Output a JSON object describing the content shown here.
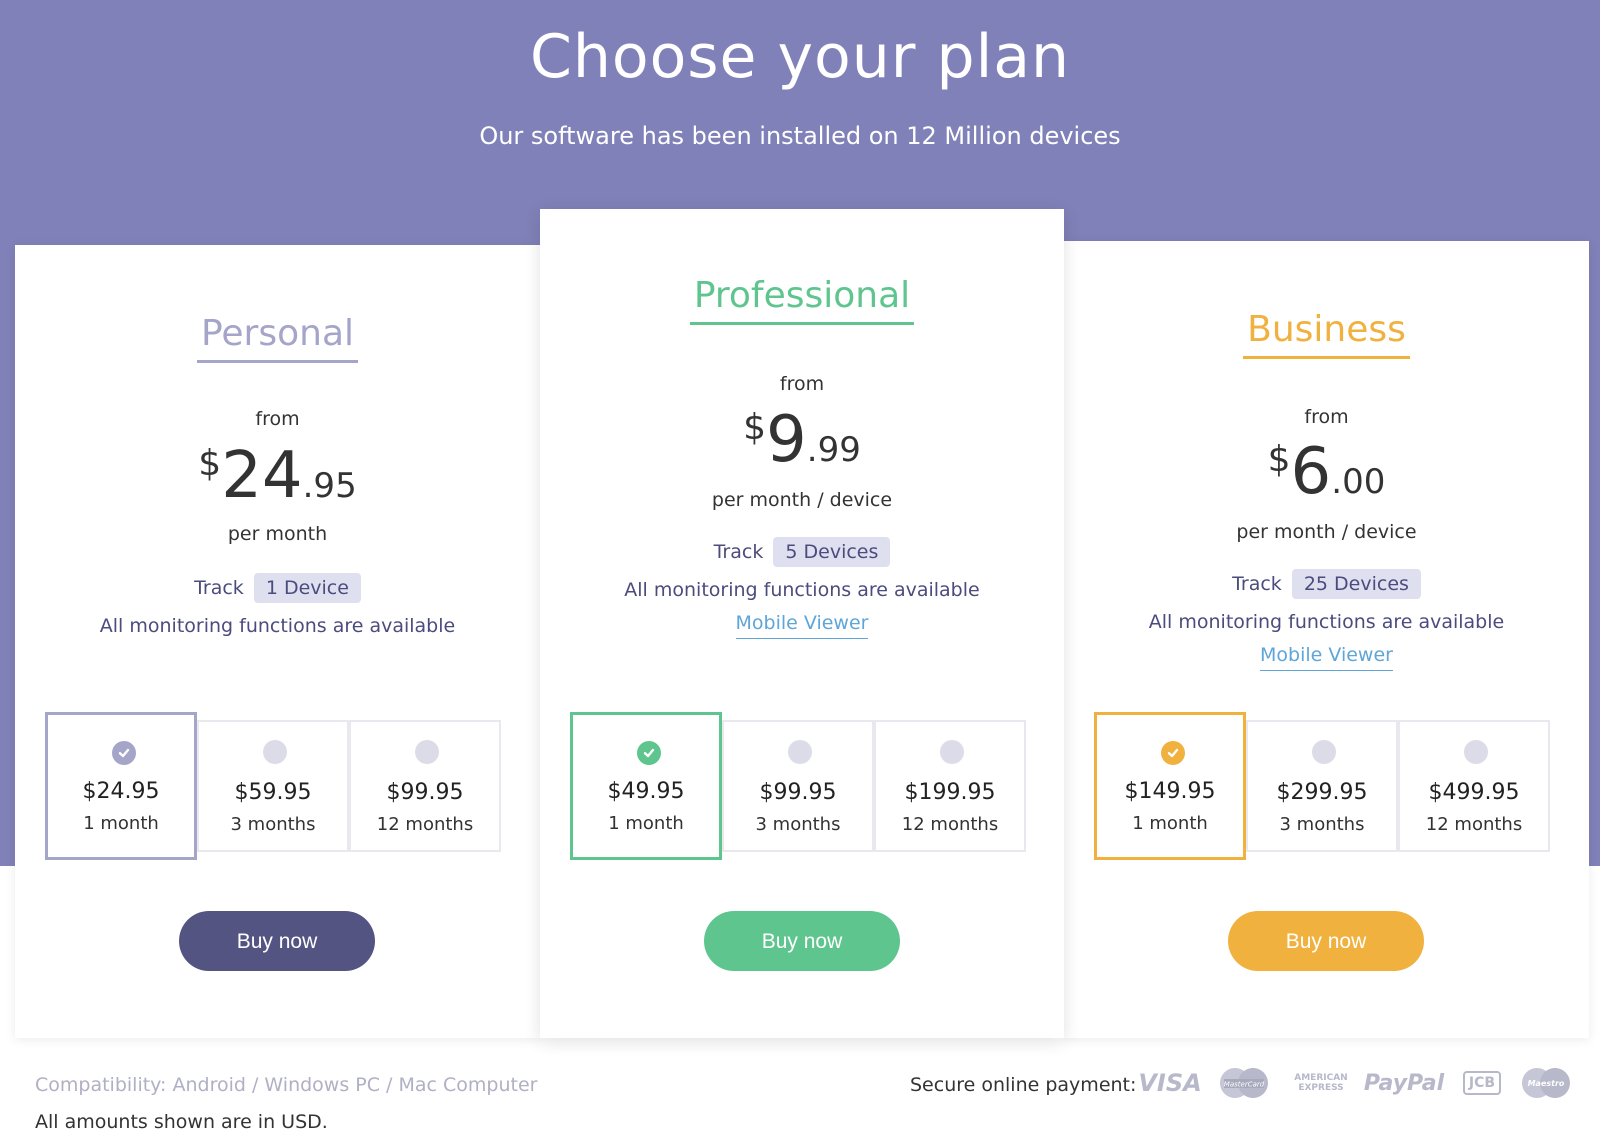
{
  "hero": {
    "title": "Choose your plan",
    "subtitle": "Our software has been installed on 12 Million devices"
  },
  "plans": [
    {
      "name": "Personal",
      "color": "#a4a5c9",
      "from": "from",
      "price_currency": "$",
      "price_int": "24",
      "price_cents": ".95",
      "per": "per month",
      "track_label": "Track",
      "devices": "1 Device",
      "functions": "All monitoring functions are available",
      "options": [
        {
          "amount": "$24.95",
          "period": "1 month",
          "selected": true
        },
        {
          "amount": "$59.95",
          "period": "3 months",
          "selected": false
        },
        {
          "amount": "$99.95",
          "period": "12 months",
          "selected": false
        }
      ],
      "buy_label": "Buy now",
      "buy_color": "#545482"
    },
    {
      "name": "Professional",
      "color": "#5fc58e",
      "from": "from",
      "price_currency": "$",
      "price_int": "9",
      "price_cents": ".99",
      "per": "per month / device",
      "track_label": "Track",
      "devices": "5 Devices",
      "functions": "All monitoring functions are available",
      "viewer": "Mobile Viewer",
      "options": [
        {
          "amount": "$49.95",
          "period": "1 month",
          "selected": true
        },
        {
          "amount": "$99.95",
          "period": "3 months",
          "selected": false
        },
        {
          "amount": "$199.95",
          "period": "12 months",
          "selected": false
        }
      ],
      "buy_label": "Buy now",
      "buy_color": "#5fc58e"
    },
    {
      "name": "Business",
      "color": "#f0b13e",
      "from": "from",
      "price_currency": "$",
      "price_int": "6",
      "price_cents": ".00",
      "per": "per month / device",
      "track_label": "Track",
      "devices": "25 Devices",
      "functions": "All monitoring functions are available",
      "viewer": "Mobile Viewer",
      "options": [
        {
          "amount": "$149.95",
          "period": "1 month",
          "selected": true
        },
        {
          "amount": "$299.95",
          "period": "3 months",
          "selected": false
        },
        {
          "amount": "$499.95",
          "period": "12 months",
          "selected": false
        }
      ],
      "buy_label": "Buy now",
      "buy_color": "#f0b13e"
    }
  ],
  "footer": {
    "compatibility": "Compatibility: Android / Windows PC / Mac Computer",
    "usd_note": "All amounts shown are in USD.",
    "payment_label": "Secure online payment:",
    "payment_methods": [
      {
        "name": "VISA",
        "icon": "visa-icon"
      },
      {
        "name": "MasterCard",
        "icon": "mastercard-icon"
      },
      {
        "name": "AMERICAN EXPRESS",
        "icon": "amex-icon"
      },
      {
        "name": "PayPal",
        "icon": "paypal-icon"
      },
      {
        "name": "JCB",
        "icon": "jcb-icon"
      },
      {
        "name": "Maestro",
        "icon": "maestro-icon"
      }
    ]
  }
}
